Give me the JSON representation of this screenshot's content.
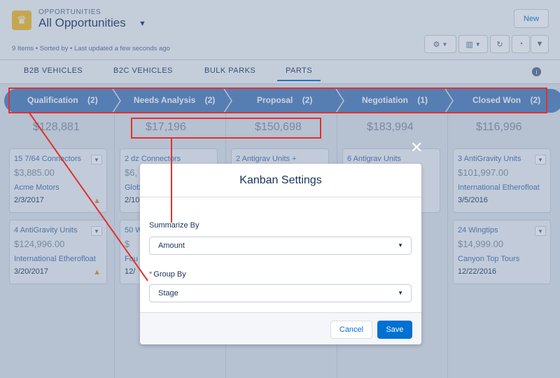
{
  "header": {
    "object_label": "OPPORTUNITIES",
    "view_title": "All Opportunities",
    "meta": "9 Items • Sorted by • Last updated a few seconds ago",
    "new_label": "New"
  },
  "tabs": [
    {
      "label": "B2B VEHICLES"
    },
    {
      "label": "B2C VEHICLES"
    },
    {
      "label": "BULK PARKS"
    },
    {
      "label": "PARTS"
    }
  ],
  "path": {
    "stages": [
      {
        "name": "Qualification",
        "count": "(2)"
      },
      {
        "name": "Needs Analysis",
        "count": "(2)"
      },
      {
        "name": "Proposal",
        "count": "(2)"
      },
      {
        "name": "Negotiation",
        "count": "(1)"
      },
      {
        "name": "Closed Won",
        "count": "(2)"
      }
    ]
  },
  "columns": [
    {
      "amount": "$128,881",
      "cards": [
        {
          "title": "15 7/64 Connectors",
          "amount": "$3,885.00",
          "account": "Acme Motors",
          "date": "2/3/2017"
        },
        {
          "title": "4 AntiGravity Units",
          "amount": "$124,996.00",
          "account": "International Etherofloat",
          "date": "3/20/2017"
        }
      ]
    },
    {
      "amount": "$17,196",
      "cards": [
        {
          "title": "2 dz Connectors",
          "amount": "$6,",
          "account": "Glob",
          "date": "2/10"
        },
        {
          "title": "50 W",
          "amount": "$",
          "account": "Fou",
          "date": "12/"
        }
      ]
    },
    {
      "amount": "$150,698",
      "cards": [
        {
          "title": "2 Antigrav Units +",
          "amount": "",
          "account": "",
          "date": ""
        }
      ]
    },
    {
      "amount": "$183,994",
      "cards": [
        {
          "title": "6 Antigrav Units",
          "amount": "",
          "account": "",
          "date": ""
        }
      ]
    },
    {
      "amount": "$116,996",
      "cards": [
        {
          "title": "3 AntiGravity Units",
          "amount": "$101,997.00",
          "account": "International Etherofloat",
          "date": "3/5/2016"
        },
        {
          "title": "24 Wingtips",
          "amount": "$14,999.00",
          "account": "Canyon Top Tours",
          "date": "12/22/2016"
        }
      ]
    }
  ],
  "modal": {
    "title": "Kanban Settings",
    "summarize_label": "Summarize By",
    "summarize_value": "Amount",
    "group_required": "*",
    "group_label": "Group By",
    "group_value": "Stage",
    "cancel_label": "Cancel",
    "save_label": "Save",
    "close_glyph": "✕"
  },
  "colors": {
    "brand": "#0070d2",
    "path": "#4b7dbd",
    "annotation": "#e0312f"
  }
}
